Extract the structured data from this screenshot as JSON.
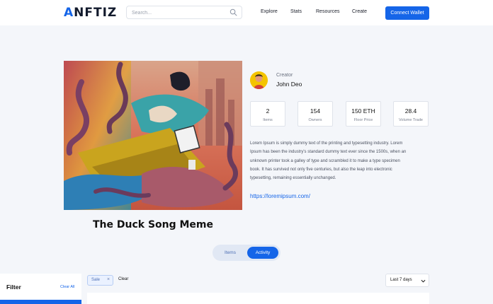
{
  "header": {
    "logo_prefix": "A",
    "logo_rest": "NFTIZ",
    "search_placeholder": "Search...",
    "nav": [
      "Explore",
      "Stats",
      "Resources",
      "Create"
    ],
    "connect_label": "Connect Wallet"
  },
  "creator": {
    "label": "Creator",
    "name": "John Deo"
  },
  "stats": [
    {
      "value": "2",
      "label": "Items"
    },
    {
      "value": "154",
      "label": "Owners"
    },
    {
      "value": "150 ETH",
      "label": "Floor Price"
    },
    {
      "value": "28.4",
      "label": "Volume Trade"
    }
  ],
  "description": [
    "Lorem Ipsum is simply dummy text of the printing and typesetting industry. Lorem",
    "Ipsum has been the industry's standard dummy text ever since the 1500s, when an",
    "unknown printer took a galley of type and scrambled it to make a type specimen",
    "book. It has survived not only five centuries, but also the leap into electronic",
    "typesetting, remaining essentially unchanged."
  ],
  "link": "https://loremipsum.com/",
  "title": "The Duck Song Meme",
  "tabs": {
    "items": "Items",
    "activity": "Activity",
    "active": "activity"
  },
  "filter": {
    "title": "Filter",
    "clear_all": "Clear All"
  },
  "chips": {
    "sale": "Sale",
    "remove": "×",
    "clear": "Clear"
  },
  "sort": {
    "value": "Last 7 days"
  },
  "colors": {
    "accent": "#1565e8",
    "background": "#f4f6fa"
  },
  "icons": {
    "search": "search-icon",
    "chevron": "chevron-down-icon"
  }
}
